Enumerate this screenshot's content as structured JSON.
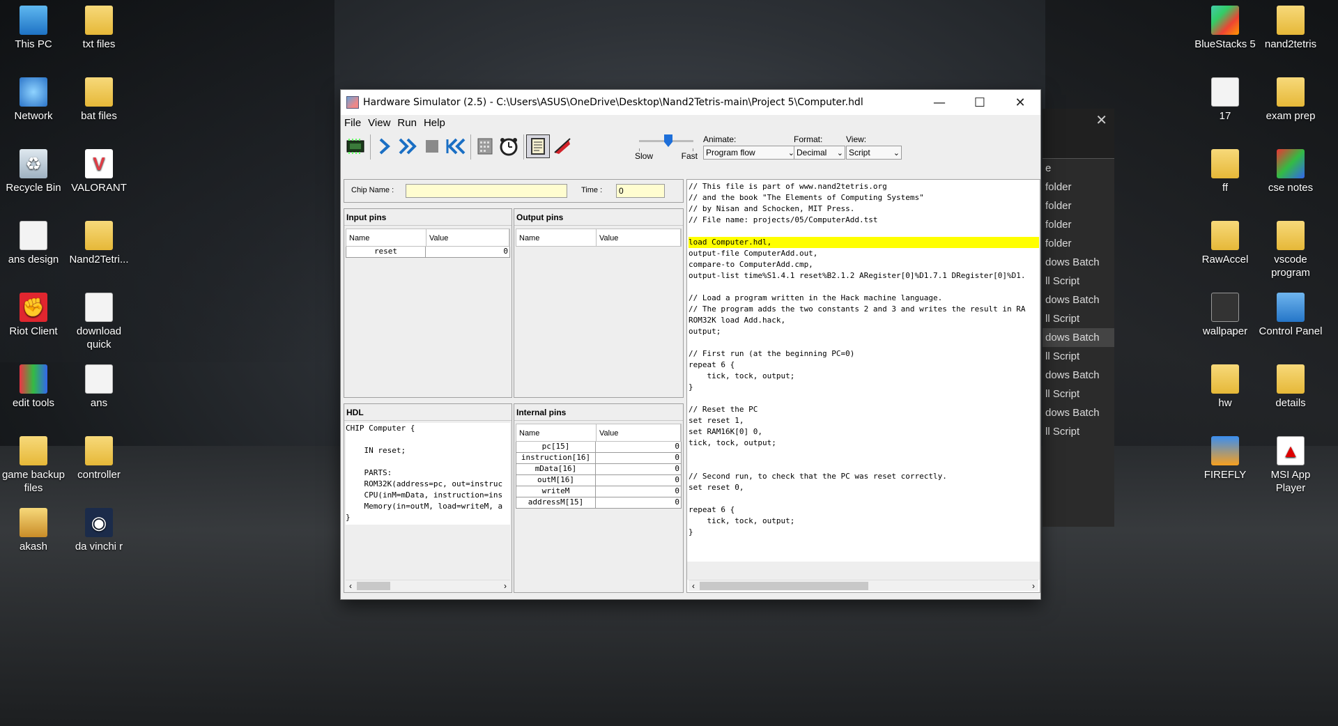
{
  "desktop": {
    "left_icons": [
      {
        "label": "This PC",
        "icon": "this-pc-icon"
      },
      {
        "label": "txt files",
        "icon": "folder-icon"
      },
      {
        "label": "Network",
        "icon": "network-icon"
      },
      {
        "label": "bat files",
        "icon": "folder-icon"
      },
      {
        "label": "Recycle Bin",
        "icon": "recycle-bin-icon"
      },
      {
        "label": "VALORANT",
        "icon": "valorant-icon"
      },
      {
        "label": "ans design",
        "icon": "document-icon"
      },
      {
        "label": "Nand2Tetri...",
        "icon": "folder-icon"
      },
      {
        "label": "Riot Client",
        "icon": "riot-client-icon"
      },
      {
        "label": "download quick",
        "icon": "document-icon"
      },
      {
        "label": "edit tools",
        "icon": "edit-tools-icon"
      },
      {
        "label": "ans",
        "icon": "document-icon"
      },
      {
        "label": "game backup files",
        "icon": "folder-icon"
      },
      {
        "label": "controller",
        "icon": "folder-icon"
      },
      {
        "label": "akash",
        "icon": "user-folder-icon"
      },
      {
        "label": "da vinchi r",
        "icon": "davinci-icon"
      }
    ],
    "right_icons": [
      {
        "label": "BlueStacks 5",
        "icon": "bluestacks-icon"
      },
      {
        "label": "nand2tetris",
        "icon": "folder-icon"
      },
      {
        "label": "17",
        "icon": "document-icon"
      },
      {
        "label": "exam prep",
        "icon": "folder-icon"
      },
      {
        "label": "ff",
        "icon": "folder-icon"
      },
      {
        "label": "cse notes",
        "icon": "cse-notes-icon"
      },
      {
        "label": "RawAccel",
        "icon": "folder-icon"
      },
      {
        "label": "vscode program",
        "icon": "folder-icon"
      },
      {
        "label": "wallpaper",
        "icon": "wallpaper-icon"
      },
      {
        "label": "Control Panel",
        "icon": "control-panel-icon"
      },
      {
        "label": "hw",
        "icon": "folder-icon"
      },
      {
        "label": "details",
        "icon": "folder-icon"
      },
      {
        "label": "FIREFLY",
        "icon": "firefly-icon"
      },
      {
        "label": "MSI App Player",
        "icon": "msi-icon"
      }
    ]
  },
  "bg_window": {
    "rows": [
      "e",
      "folder",
      "folder",
      "folder",
      "folder",
      "dows Batch",
      "ll Script",
      "dows Batch",
      "ll Script",
      "dows Batch",
      "ll Script",
      "dows Batch",
      "ll Script",
      "dows Batch",
      "ll Script"
    ]
  },
  "window": {
    "title": "Hardware Simulator (2.5) - C:\\Users\\ASUS\\OneDrive\\Desktop\\Nand2Tetris-main\\Project 5\\Computer.hdl",
    "menu": [
      "File",
      "View",
      "Run",
      "Help"
    ],
    "toolbar": {
      "slow_label": "Slow",
      "fast_label": "Fast",
      "speed_level": 0.5,
      "animate_label": "Animate:",
      "animate_value": "Program flow",
      "format_label": "Format:",
      "format_value": "Decimal",
      "view_label": "View:",
      "view_value": "Script"
    },
    "chip": {
      "chip_name_label": "Chip Name :",
      "chip_name_value": "",
      "time_label": "Time :",
      "time_value": "0"
    },
    "input_pins": {
      "title": "Input pins",
      "col_name": "Name",
      "col_value": "Value",
      "rows": [
        {
          "name": "reset",
          "value": "0"
        }
      ]
    },
    "output_pins": {
      "title": "Output pins",
      "col_name": "Name",
      "col_value": "Value",
      "rows": []
    },
    "hdl": {
      "title": "HDL",
      "lines": [
        "CHIP Computer {",
        "",
        "    IN reset;",
        "",
        "    PARTS:",
        "    ROM32K(address=pc, out=instruc",
        "    CPU(inM=mData, instruction=ins",
        "    Memory(in=outM, load=writeM, a",
        "}"
      ]
    },
    "internal_pins": {
      "title": "Internal pins",
      "col_name": "Name",
      "col_value": "Value",
      "rows": [
        {
          "name": "pc[15]",
          "value": "0"
        },
        {
          "name": "instruction[16]",
          "value": "0"
        },
        {
          "name": "mData[16]",
          "value": "0"
        },
        {
          "name": "outM[16]",
          "value": "0"
        },
        {
          "name": "writeM",
          "value": "0"
        },
        {
          "name": "addressM[15]",
          "value": "0"
        }
      ]
    },
    "script": {
      "highlight_line": 5,
      "lines": [
        "// This file is part of www.nand2tetris.org",
        "// and the book \"The Elements of Computing Systems\"",
        "// by Nisan and Schocken, MIT Press.",
        "// File name: projects/05/ComputerAdd.tst",
        "",
        "load Computer.hdl,",
        "output-file ComputerAdd.out,",
        "compare-to ComputerAdd.cmp,",
        "output-list time%S1.4.1 reset%B2.1.2 ARegister[0]%D1.7.1 DRegister[0]%D1.",
        "",
        "// Load a program written in the Hack machine language.",
        "// The program adds the two constants 2 and 3 and writes the result in RA",
        "ROM32K load Add.hack,",
        "output;",
        "",
        "// First run (at the beginning PC=0)",
        "repeat 6 {",
        "    tick, tock, output;",
        "}",
        "",
        "// Reset the PC",
        "set reset 1,",
        "set RAM16K[0] 0,",
        "tick, tock, output;",
        "",
        "",
        "// Second run, to check that the PC was reset correctly.",
        "set reset 0,",
        "",
        "repeat 6 {",
        "    tick, tock, output;",
        "}"
      ]
    }
  }
}
